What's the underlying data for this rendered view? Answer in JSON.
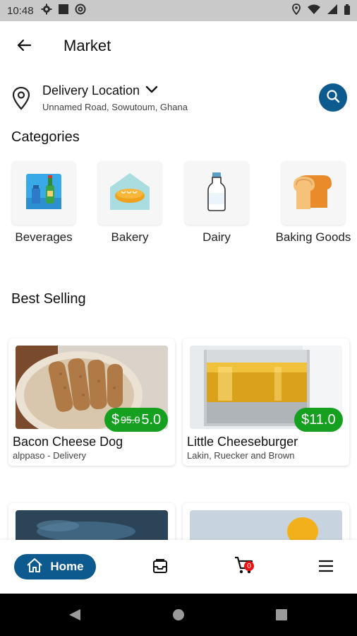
{
  "status_bar": {
    "time": "10:48",
    "left_icons": [
      "gear-icon",
      "square-icon",
      "at-icon"
    ],
    "right_icons": [
      "location-icon",
      "wifi-icon",
      "signal-icon",
      "battery-icon"
    ]
  },
  "app_bar": {
    "title": "Market",
    "back_icon": "arrow-left-icon"
  },
  "location": {
    "label": "Delivery Location",
    "address": "Unnamed Road, Sowutoum, Ghana"
  },
  "categories": {
    "title": "Categories",
    "items": [
      {
        "label": "Beverages",
        "icon": "beverages-icon"
      },
      {
        "label": "Bakery",
        "icon": "bakery-icon"
      },
      {
        "label": "Dairy",
        "icon": "milk-bottle-icon"
      },
      {
        "label": "Baking Goods",
        "icon": "bread-loaf-icon"
      }
    ]
  },
  "best_selling": {
    "title": "Best Selling",
    "items": [
      {
        "name": "Bacon Cheese Dog",
        "subtitle": "alppaso - Delivery",
        "currency": "$",
        "old_price": "95.0",
        "price": "5.0"
      },
      {
        "name": "Little Cheeseburger",
        "subtitle": "Lakin, Ruecker and Brown",
        "price_label": "$11.0"
      }
    ]
  },
  "bottom_nav": {
    "home_label": "Home",
    "cart_count": "0"
  },
  "colors": {
    "primary": "#0d5a8f",
    "price_green": "#15a020",
    "badge_red": "#e11111"
  }
}
